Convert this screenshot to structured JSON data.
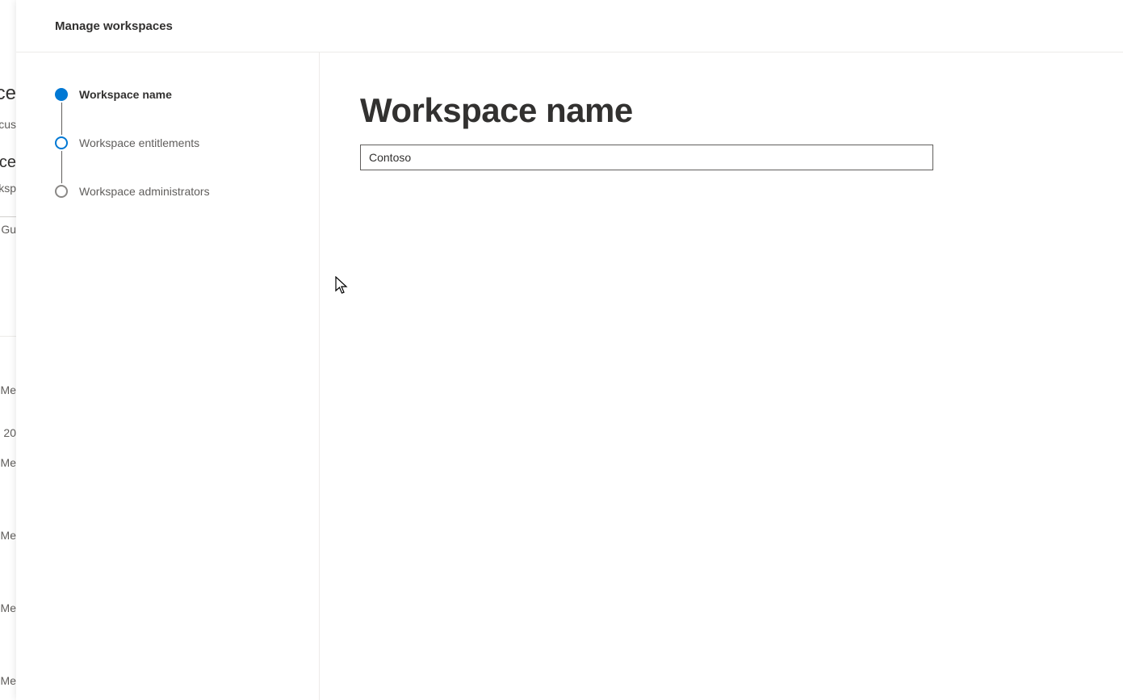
{
  "header": {
    "title": "Manage workspaces"
  },
  "stepper": {
    "steps": [
      {
        "label": "Workspace name",
        "state": "filled",
        "active": true
      },
      {
        "label": "Workspace entitlements",
        "state": "outlined-active",
        "active": false
      },
      {
        "label": "Workspace administrators",
        "state": "outlined-inactive",
        "active": false
      }
    ]
  },
  "main": {
    "heading": "Workspace name",
    "input_value": "Contoso"
  },
  "bg_fragments": {
    "f1": "ce",
    "f2": "cus",
    "f3": "ice",
    "f4": "rksp",
    "f5": "l Gu",
    "f6": "Me",
    "f7": "20",
    "f8": "Me",
    "f9": "Me",
    "f10": "Me",
    "f11": "Me"
  }
}
